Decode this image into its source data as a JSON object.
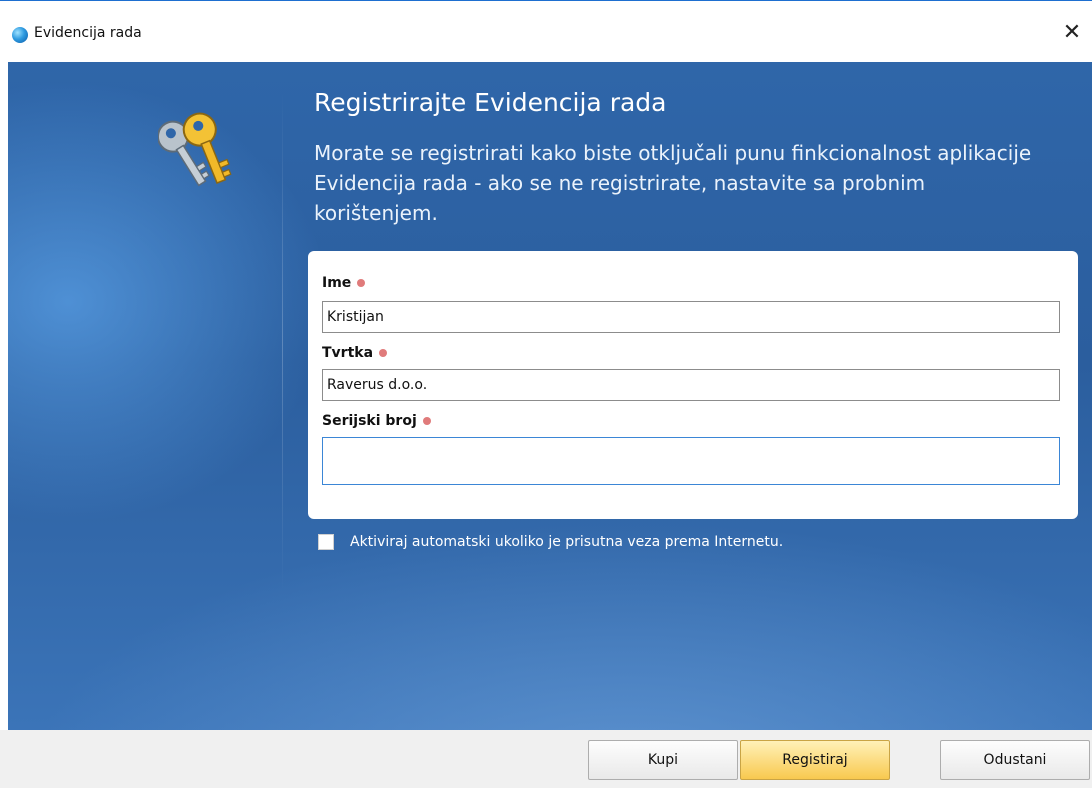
{
  "window": {
    "title": "Evidencija rada",
    "close_symbol": "✕",
    "icon": "app-globe-icon"
  },
  "header": {
    "icon": "keys-icon",
    "heading": "Registrirajte Evidencija rada",
    "description": "Morate se registrirati kako biste otključali punu finkcionalnost aplikacije Evidencija rada - ako se ne registrirate, nastavite sa probnim korištenjem."
  },
  "form": {
    "name": {
      "label": "Ime",
      "value": "Kristijan",
      "required": true
    },
    "company": {
      "label": "Tvrtka",
      "value": "Raverus d.o.o.",
      "required": true
    },
    "serial": {
      "label": "Serijski broj",
      "value": "",
      "required": true
    }
  },
  "auto_activate": {
    "label": "Aktiviraj automatski ukoliko je prisutna veza prema Internetu.",
    "checked": false
  },
  "buttons": {
    "buy": "Kupi",
    "register": "Registiraj",
    "cancel": "Odustani"
  },
  "colors": {
    "background_blue": "#2f66a9",
    "required_dot": "#e07b7b",
    "primary_button": "#f8c94f"
  }
}
